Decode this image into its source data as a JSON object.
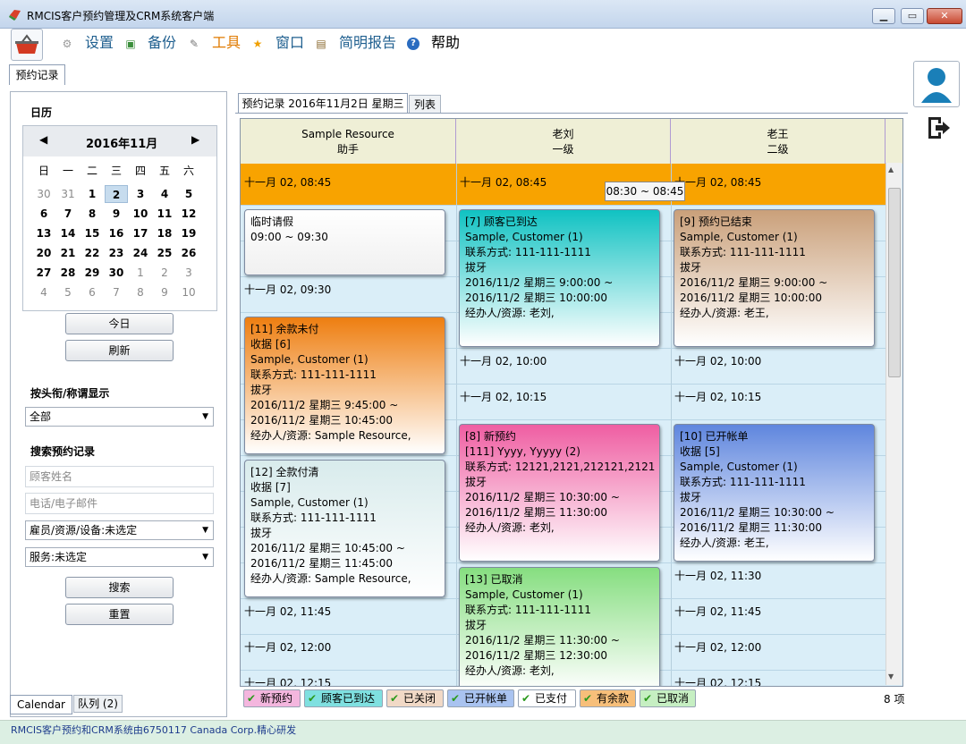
{
  "window": {
    "title": "RMCIS客户预约管理及CRM系统客户端"
  },
  "menu": [
    {
      "label": "设置",
      "icon": "gear-icon",
      "color": "#1f5f8f"
    },
    {
      "label": "备份",
      "icon": "backup-icon",
      "color": "#1f5f8f"
    },
    {
      "label": "工具",
      "icon": "wrench-icon",
      "color": "#e07a00"
    },
    {
      "label": "窗口",
      "icon": "star-icon",
      "color": "#1f5f8f"
    },
    {
      "label": "简明报告",
      "icon": "clipboard-icon",
      "color": "#1f5f8f"
    },
    {
      "label": "帮助",
      "icon": "help-icon",
      "color": "#000000"
    }
  ],
  "doc_tab": "预约记录",
  "sidebar": {
    "calendar_title": "日历",
    "month": "2016年11月",
    "weekdays": [
      "日",
      "一",
      "二",
      "三",
      "四",
      "五",
      "六"
    ],
    "weeks": [
      [
        "30",
        "31",
        "1",
        "2",
        "3",
        "4",
        "5"
      ],
      [
        "6",
        "7",
        "8",
        "9",
        "10",
        "11",
        "12"
      ],
      [
        "13",
        "14",
        "15",
        "16",
        "17",
        "18",
        "19"
      ],
      [
        "20",
        "21",
        "22",
        "23",
        "24",
        "25",
        "26"
      ],
      [
        "27",
        "28",
        "29",
        "30",
        "1",
        "2",
        "3"
      ],
      [
        "4",
        "5",
        "6",
        "7",
        "8",
        "9",
        "10"
      ]
    ],
    "selected_day": "2",
    "today_button": "今日",
    "refresh_button": "刷新",
    "display_label": "按头衔/称谓显示",
    "display_value": "全部",
    "search_label": "搜索预约记录",
    "name_placeholder": "顾客姓名",
    "contact_placeholder": "电话/电子邮件",
    "staff_value": "雇员/资源/设备:未选定",
    "service_value": "服务:未选定",
    "search_button": "搜索",
    "reset_button": "重置",
    "tab_calendar": "Calendar",
    "tab_queue": "队列 (2)"
  },
  "main_tabs": [
    "预约记录 2016年11月2日 星期三",
    "列表"
  ],
  "columns": [
    {
      "name": "Sample Resource",
      "title": "助手"
    },
    {
      "name": "老刘",
      "title": "一级"
    },
    {
      "name": "老王",
      "title": "二级"
    }
  ],
  "slots": {
    "col0": [
      "十一月 02, 08:45",
      "十一月 02, 09:30",
      "十一月 02, 11:45",
      "十一月 02, 12:00",
      "十一月 02, 12:15"
    ],
    "col1": [
      "十一月 02, 08:45",
      "十一月 02, 10:00",
      "十一月 02, 10:15"
    ],
    "col2": [
      "十一月 02, 08:45",
      "十一月 02, 10:00",
      "十一月 02, 10:15",
      "十一月 02, 11:30",
      "十一月 02, 11:45",
      "十一月 02, 12:00",
      "十一月 02, 12:15"
    ]
  },
  "tooltip": "08:30 ~ 08:45",
  "appointments": {
    "leave": {
      "lines": [
        "临时请假",
        "09:00 ~ 09:30"
      ],
      "color": "#ffffff"
    },
    "a7": {
      "lines": [
        "[7] 顾客已到达",
        "Sample, Customer (1)",
        "联系方式: 111-111-1111",
        "拔牙",
        "2016/11/2 星期三 9:00:00 ~",
        "2016/11/2 星期三 10:00:00",
        "经办人/资源: 老刘,"
      ],
      "color": "#12c4c4"
    },
    "a9": {
      "lines": [
        "[9] 预约已结束",
        "Sample, Customer (1)",
        "联系方式: 111-111-1111",
        "拔牙",
        "2016/11/2 星期三 9:00:00 ~",
        "2016/11/2 星期三 10:00:00",
        "经办人/资源: 老王,"
      ],
      "color": "#d2a884"
    },
    "a11": {
      "lines": [
        "[11] 余款未付",
        "收据 [6]",
        "Sample, Customer (1)",
        "联系方式: 111-111-1111",
        "拔牙",
        "2016/11/2 星期三 9:45:00 ~",
        "2016/11/2 星期三 10:45:00",
        "经办人/资源: Sample Resource,"
      ],
      "color": "#f08a1a"
    },
    "a12": {
      "lines": [
        "[12] 全款付清",
        "收据 [7]",
        "Sample, Customer (1)",
        "联系方式: 111-111-1111",
        "拔牙",
        "2016/11/2 星期三 10:45:00 ~",
        "2016/11/2 星期三 11:45:00",
        "经办人/资源: Sample Resource,"
      ],
      "color": "#dfeff0"
    },
    "a8": {
      "lines": [
        "[8] 新预约",
        "[111] Yyyy, Yyyyy (2)",
        "联系方式: 12121,2121,212121,2121",
        "拔牙",
        "2016/11/2 星期三 10:30:00 ~",
        "2016/11/2 星期三 11:30:00",
        "经办人/资源: 老刘,"
      ],
      "color": "#f06aa8"
    },
    "a10": {
      "lines": [
        "[10] 已开帐单",
        "收据 [5]",
        "Sample, Customer (1)",
        "联系方式: 111-111-1111",
        "拔牙",
        "2016/11/2 星期三 10:30:00 ~",
        "2016/11/2 星期三 11:30:00",
        "经办人/资源: 老王,"
      ],
      "color": "#6a8fe0"
    },
    "a13": {
      "lines": [
        "[13] 已取消",
        "Sample, Customer (1)",
        "联系方式: 111-111-1111",
        "拔牙",
        "2016/11/2 星期三 11:30:00 ~",
        "2016/11/2 星期三 12:30:00",
        "经办人/资源: 老刘,"
      ],
      "color": "#8ee08a"
    }
  },
  "legend": [
    {
      "label": "新预约",
      "color": "#f4b6de"
    },
    {
      "label": "顾客已到达",
      "color": "#7fe0e0"
    },
    {
      "label": "已关闭",
      "color": "#f1d9c6"
    },
    {
      "label": "已开帐单",
      "color": "#a9c3f0"
    },
    {
      "label": "已支付",
      "color": "#ffffff"
    },
    {
      "label": "有余款",
      "color": "#f7bf7a"
    },
    {
      "label": "已取消",
      "color": "#c6efc2"
    }
  ],
  "count": "8 项",
  "status": "RMCIS客户预约和CRM系统由6750117 Canada Corp.精心研发"
}
